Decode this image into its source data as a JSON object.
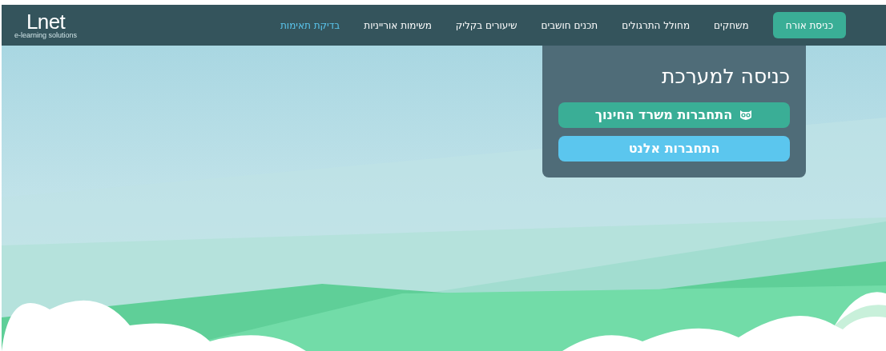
{
  "logo": {
    "name": "Lnet",
    "tagline": "e-learning solutions"
  },
  "nav": {
    "guest_button": "כניסת אורח",
    "items": [
      {
        "label": "משחקים",
        "selected": false
      },
      {
        "label": "מחולל התרגולים",
        "selected": false
      },
      {
        "label": "תכנים חושבים",
        "selected": false
      },
      {
        "label": "שיעורים בקליק",
        "selected": false
      },
      {
        "label": "משימות אורייניות",
        "selected": false
      },
      {
        "label": "בדיקת תאימות",
        "selected": true
      }
    ]
  },
  "login_panel": {
    "title": "כניסה למערכת",
    "buttons": [
      {
        "label": "התחברות משרד החינוך",
        "kind": "ministry"
      },
      {
        "label": "התחברות אלנט",
        "kind": "lnet"
      }
    ]
  }
}
